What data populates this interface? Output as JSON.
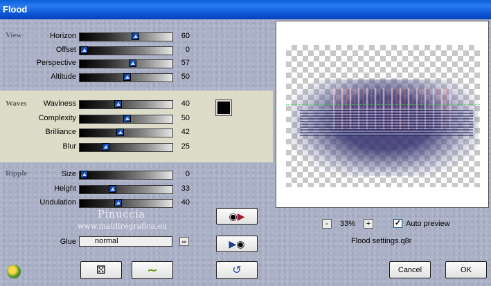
{
  "window": {
    "title": "Flood"
  },
  "sections": {
    "view": {
      "label": "View",
      "controls": [
        {
          "label": "Horizon",
          "value": "60",
          "fraction": 0.6
        },
        {
          "label": "Offset",
          "value": "0",
          "fraction": 0.0
        },
        {
          "label": "Perspective",
          "value": "57",
          "fraction": 0.57
        },
        {
          "label": "Altitude",
          "value": "50",
          "fraction": 0.5
        }
      ]
    },
    "waves": {
      "label": "Waves",
      "controls": [
        {
          "label": "Waviness",
          "value": "40",
          "fraction": 0.4
        },
        {
          "label": "Complexity",
          "value": "50",
          "fraction": 0.5
        },
        {
          "label": "Brilliance",
          "value": "42",
          "fraction": 0.42
        },
        {
          "label": "Blur",
          "value": "25",
          "fraction": 0.25
        }
      ],
      "color_swatch": "#000000"
    },
    "ripple": {
      "label": "Ripple",
      "controls": [
        {
          "label": "Size",
          "value": "0",
          "fraction": 0.0
        },
        {
          "label": "Height",
          "value": "33",
          "fraction": 0.33
        },
        {
          "label": "Undulation",
          "value": "40",
          "fraction": 0.4
        }
      ]
    }
  },
  "watermark": {
    "line1": "Pinuccia",
    "line2": "www.maidiregrafica.eu"
  },
  "glue": {
    "label": "Glue",
    "value": "normal"
  },
  "zoom": {
    "minus": "-",
    "value": "33%",
    "plus": "+"
  },
  "auto_preview": {
    "label": "Auto preview",
    "checked": true,
    "mark": "✓"
  },
  "settings_file": "Flood settings.q8r",
  "buttons": {
    "cancel": "Cancel",
    "ok": "OK"
  },
  "colors": {
    "accent": "#0a5fd8",
    "panel": "#aab0c6",
    "band": "#dcdcc8"
  }
}
